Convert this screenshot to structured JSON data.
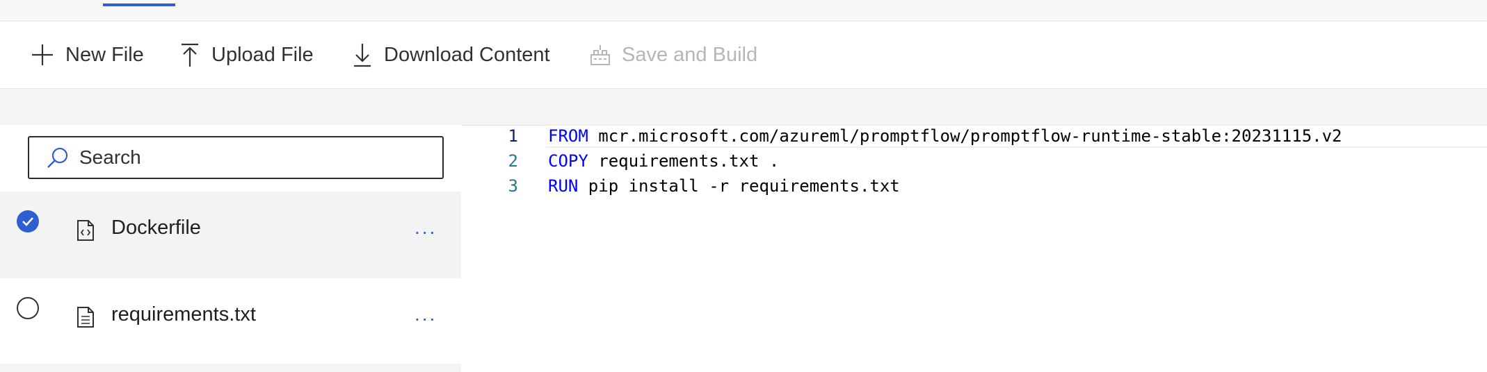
{
  "toolbar": {
    "new_file": "New File",
    "upload_file": "Upload File",
    "download_content": "Download Content",
    "save_and_build": "Save and Build"
  },
  "search": {
    "placeholder": "Search"
  },
  "files": [
    {
      "name": "Dockerfile",
      "selected": true,
      "icon": "code-file-icon",
      "more": "..."
    },
    {
      "name": "requirements.txt",
      "selected": false,
      "icon": "text-file-icon",
      "more": "..."
    }
  ],
  "editor": {
    "lines": [
      {
        "number": "1",
        "keyword": "FROM",
        "text": " mcr.microsoft.com/azureml/promptflow/promptflow-runtime-stable:20231115.v2"
      },
      {
        "number": "2",
        "keyword": "COPY",
        "text": " requirements.txt ."
      },
      {
        "number": "3",
        "keyword": "RUN",
        "text": " pip install -r requirements.txt"
      }
    ]
  },
  "colors": {
    "accent": "#2d5fd2",
    "keyword": "#0000ff",
    "line_number": "#237893"
  }
}
